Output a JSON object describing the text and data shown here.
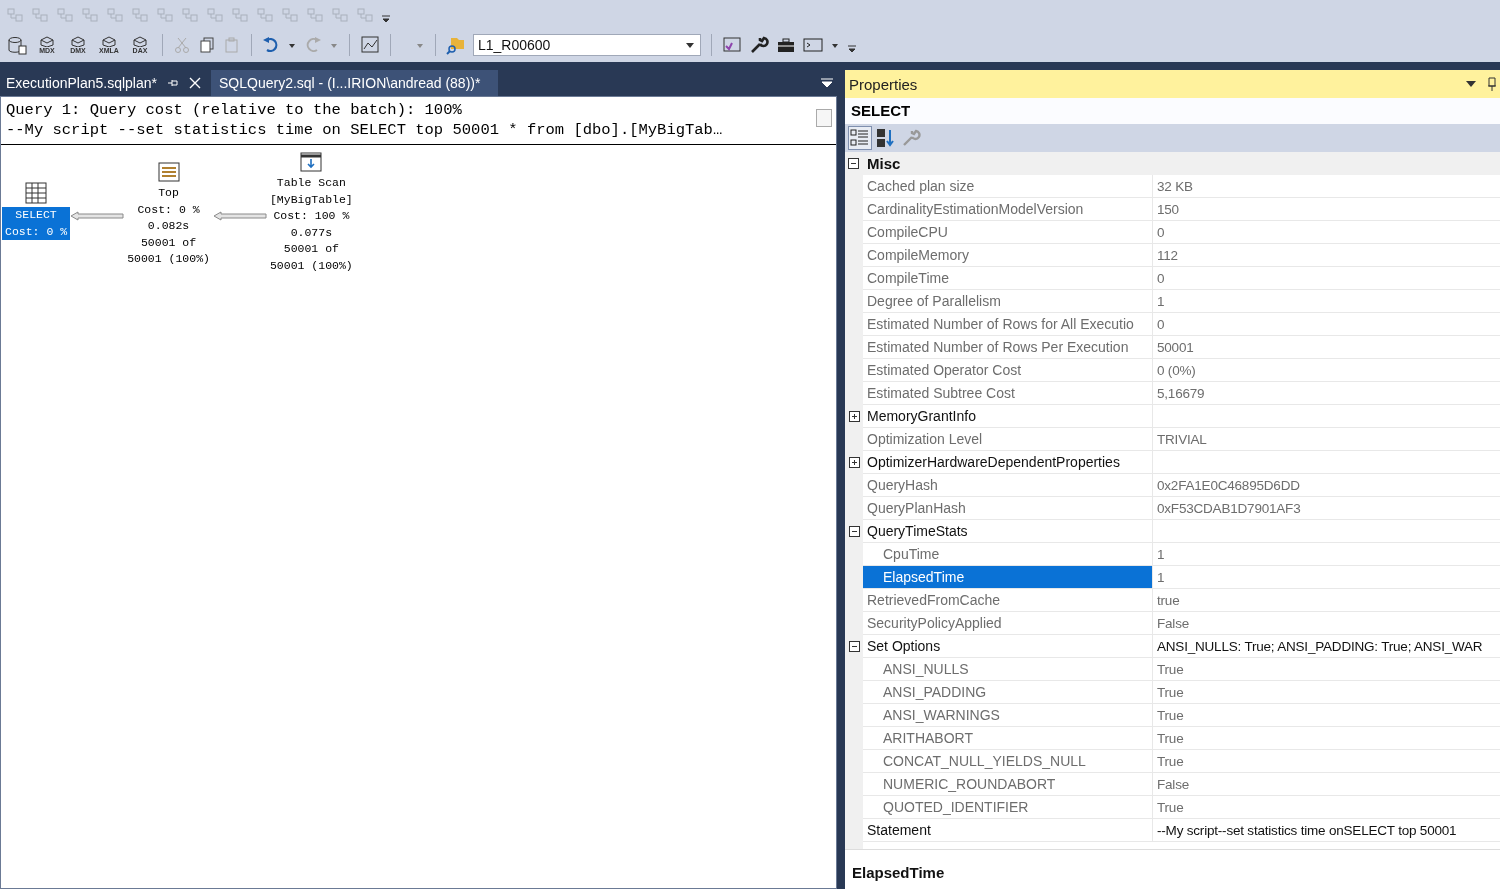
{
  "toolbar": {
    "query_buttons": [
      "MDX",
      "DMX",
      "XMLA",
      "DAX"
    ],
    "database": "L1_R00600"
  },
  "tabs": [
    {
      "label": "ExecutionPlan5.sqlplan*",
      "selected": true
    },
    {
      "label": "SQLQuery2.sql - (I...IRION\\andread (88))*",
      "selected": false
    }
  ],
  "plan": {
    "header": [
      "Query 1: Query cost (relative to the batch): 100%",
      "--My script --set statistics time on SELECT  top 50001 * from [dbo].[MyBigTab…"
    ],
    "nodes": [
      {
        "kind": "select",
        "lines": [
          "SELECT",
          "Cost: 0 %"
        ],
        "selected": true
      },
      {
        "kind": "top",
        "lines": [
          "Top",
          "Cost: 0 %",
          "0.082s",
          "50001 of",
          "50001 (100%)"
        ],
        "selected": false
      },
      {
        "kind": "scan",
        "lines": [
          "Table Scan",
          "[MyBigTable]",
          "Cost: 100 %",
          "0.077s",
          "50001 of",
          "50001 (100%)"
        ],
        "selected": false
      }
    ]
  },
  "properties": {
    "title": "Properties",
    "object": "SELECT",
    "categories": [
      {
        "name": "Misc",
        "expanded": true,
        "rows": [
          {
            "name": "Cached plan size",
            "value": "32 KB",
            "readonly": true,
            "selected": false
          },
          {
            "name": "CardinalityEstimationModelVersion",
            "value": "150",
            "readonly": true,
            "selected": false
          },
          {
            "name": "CompileCPU",
            "value": "0",
            "readonly": true,
            "selected": false
          },
          {
            "name": "CompileMemory",
            "value": "112",
            "readonly": true,
            "selected": false
          },
          {
            "name": "CompileTime",
            "value": "0",
            "readonly": true,
            "selected": false
          },
          {
            "name": "Degree of Parallelism",
            "value": "1",
            "readonly": true,
            "selected": false
          },
          {
            "name": "Estimated Number of Rows for All Executio",
            "value": "0",
            "readonly": true,
            "selected": false
          },
          {
            "name": "Estimated Number of Rows Per Execution",
            "value": "50001",
            "readonly": true,
            "selected": false
          },
          {
            "name": "Estimated Operator Cost",
            "value": "0 (0%)",
            "readonly": true,
            "selected": false
          },
          {
            "name": "Estimated Subtree Cost",
            "value": "5,16679",
            "readonly": true,
            "selected": false
          },
          {
            "name": "MemoryGrantInfo",
            "readonly": false,
            "selected": false,
            "expanded": false
          },
          {
            "name": "Optimization Level",
            "value": "TRIVIAL",
            "readonly": true,
            "selected": false
          },
          {
            "name": "OptimizerHardwareDependentProperties",
            "readonly": false,
            "selected": false,
            "expanded": false
          },
          {
            "name": "QueryHash",
            "value": "0x2FA1E0C46895D6DD",
            "readonly": true,
            "selected": false
          },
          {
            "name": "QueryPlanHash",
            "value": "0xF53CDAB1D7901AF3",
            "readonly": true,
            "selected": false
          },
          {
            "name": "QueryTimeStats",
            "readonly": false,
            "selected": false,
            "expanded": true,
            "children": [
              {
                "name": "CpuTime",
                "value": "1",
                "readonly": true,
                "selected": false
              },
              {
                "name": "ElapsedTime",
                "value": "1",
                "readonly": true,
                "selected": true
              }
            ]
          },
          {
            "name": "RetrievedFromCache",
            "value": "true",
            "readonly": true,
            "selected": false
          },
          {
            "name": "SecurityPolicyApplied",
            "value": "False",
            "readonly": true,
            "selected": false
          },
          {
            "name": "Set Options",
            "value": "ANSI_NULLS: True; ANSI_PADDING: True; ANSI_WAR",
            "readonly": false,
            "selected": false,
            "expanded": true,
            "children": [
              {
                "name": "ANSI_NULLS",
                "value": "True",
                "readonly": true,
                "selected": false
              },
              {
                "name": "ANSI_PADDING",
                "value": "True",
                "readonly": true,
                "selected": false
              },
              {
                "name": "ANSI_WARNINGS",
                "value": "True",
                "readonly": true,
                "selected": false
              },
              {
                "name": "ARITHABORT",
                "value": "True",
                "readonly": true,
                "selected": false
              },
              {
                "name": "CONCAT_NULL_YIELDS_NULL",
                "value": "True",
                "readonly": true,
                "selected": false
              },
              {
                "name": "NUMERIC_ROUNDABORT",
                "value": "False",
                "readonly": true,
                "selected": false
              },
              {
                "name": "QUOTED_IDENTIFIER",
                "value": "True",
                "readonly": true,
                "selected": false
              }
            ]
          },
          {
            "name": "Statement",
            "value": "--My script--set statistics time onSELECT  top 50001",
            "readonly": false,
            "selected": false
          }
        ]
      }
    ],
    "description": "ElapsedTime"
  }
}
